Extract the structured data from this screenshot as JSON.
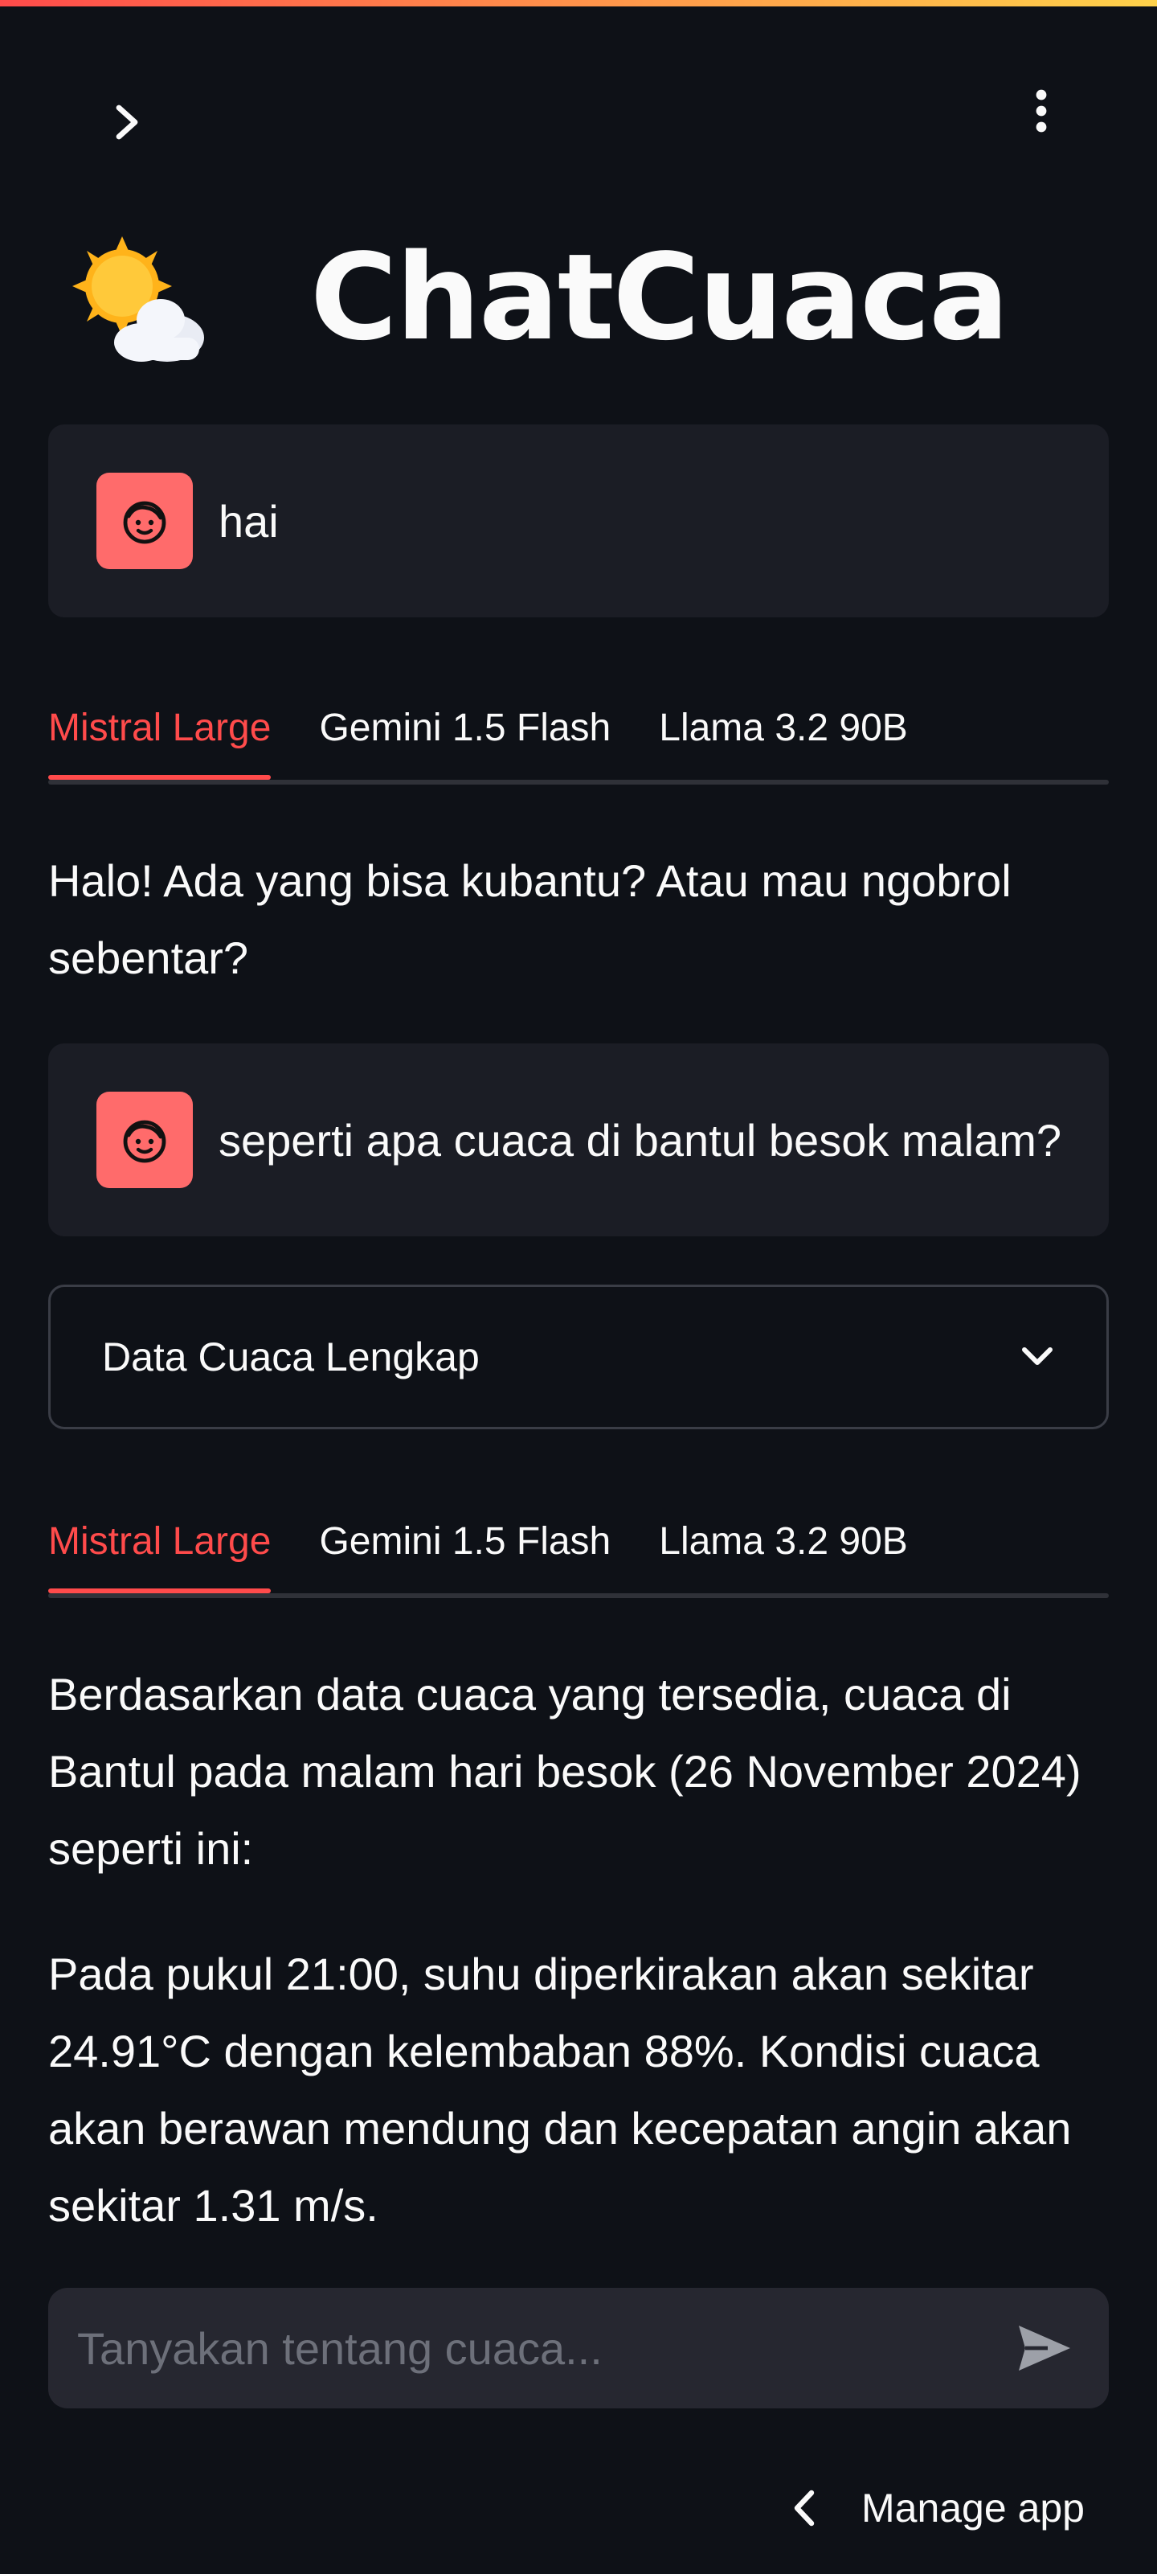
{
  "app": {
    "title": "ChatCuaca",
    "title_icon": "sun-behind-cloud-icon"
  },
  "header": {
    "sidebar_toggle_icon": "chevron-right-icon",
    "menu_icon": "kebab-menu-icon"
  },
  "messages": [
    {
      "role": "user",
      "text": "hai"
    },
    {
      "role": "assistant",
      "tabs": [
        "Mistral Large",
        "Gemini 1.5 Flash",
        "Llama 3.2 90B"
      ],
      "active_tab": 0,
      "paragraphs": [
        "Halo! Ada yang bisa kubantu? Atau mau ngobrol sebentar?"
      ]
    },
    {
      "role": "user",
      "text": "seperti apa cuaca di bantul besok malam?"
    },
    {
      "role": "assistant",
      "expander": {
        "label": "Data Cuaca Lengkap"
      },
      "tabs": [
        "Mistral Large",
        "Gemini 1.5 Flash",
        "Llama 3.2 90B"
      ],
      "active_tab": 0,
      "paragraphs": [
        "Berdasarkan data cuaca yang tersedia, cuaca di Bantul pada malam hari besok (26 November 2024) seperti ini:",
        "Pada pukul 21:00, suhu diperkirakan akan sekitar 24.91°C dengan kelembaban 88%. Kondisi cuaca akan berawan mendung dan kecepatan angin akan sekitar 1.31 m/s."
      ]
    }
  ],
  "chat_input": {
    "placeholder": "Tanyakan tentang cuaca...",
    "value": ""
  },
  "footer": {
    "manage_app_label": "Manage app"
  },
  "colors": {
    "background": "#0e1117",
    "accent": "#ff4b4b",
    "avatar": "#ff6b6b",
    "message_bg": "#1b1d25",
    "input_bg": "#262730"
  }
}
